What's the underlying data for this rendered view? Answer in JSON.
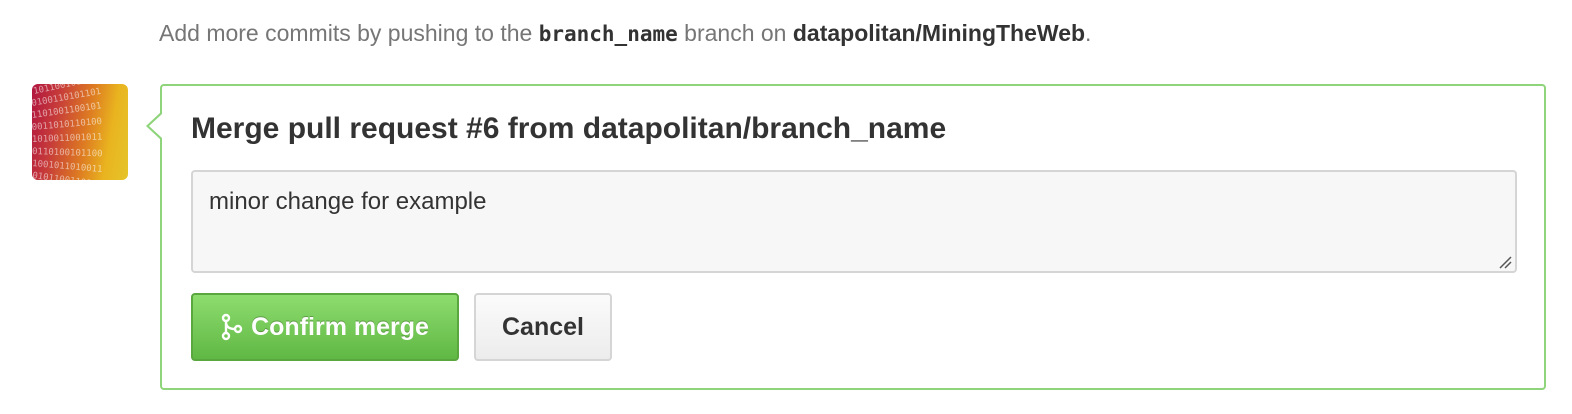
{
  "hint": {
    "prefix": "Add more commits by pushing to the",
    "branch": "branch_name",
    "middle": "branch on",
    "repo": "datapolitan/MiningTheWeb",
    "suffix": "."
  },
  "merge": {
    "title": "Merge pull request #6 from datapolitan/branch_name",
    "message": "minor change for example",
    "confirm_label": "Confirm merge",
    "cancel_label": "Cancel"
  },
  "colors": {
    "panel_border": "#8ed47a",
    "confirm_button": "#6cc644"
  },
  "icons": {
    "merge_icon": "git-merge-icon",
    "avatar": "binary-code-avatar"
  }
}
